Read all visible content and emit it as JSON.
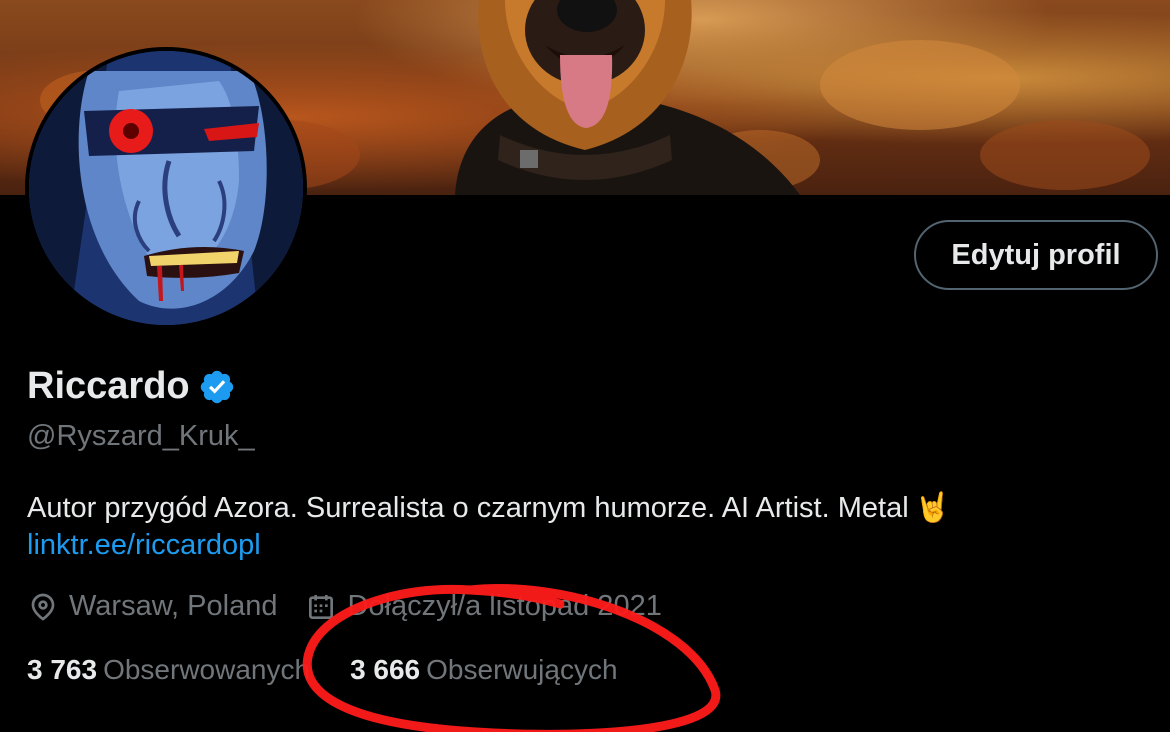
{
  "profile": {
    "display_name": "Riccardo",
    "handle": "@Ryszard_Kruk_",
    "bio": "Autor przygód Azora. Surrealista o czarnym humorze. AI Artist. Metal",
    "bio_emoji": "🤘",
    "link": "linktr.ee/riccardopl",
    "location": "Warsaw, Poland",
    "joined": "Dołączył/a listopad 2021",
    "verified_icon": "verified-badge-icon",
    "location_icon": "location-pin-icon",
    "calendar_icon": "calendar-icon"
  },
  "actions": {
    "edit_profile": "Edytuj profil"
  },
  "stats": {
    "following_count": "3 763",
    "following_label": "Obserwowanych",
    "followers_count": "3 666",
    "followers_label": "Obserwujących"
  },
  "colors": {
    "background": "#000000",
    "text_primary": "#e7e9ea",
    "text_secondary": "#71767b",
    "link": "#1d9bf0",
    "verified": "#1d9bf0",
    "annotation": "#ff1a1a"
  }
}
